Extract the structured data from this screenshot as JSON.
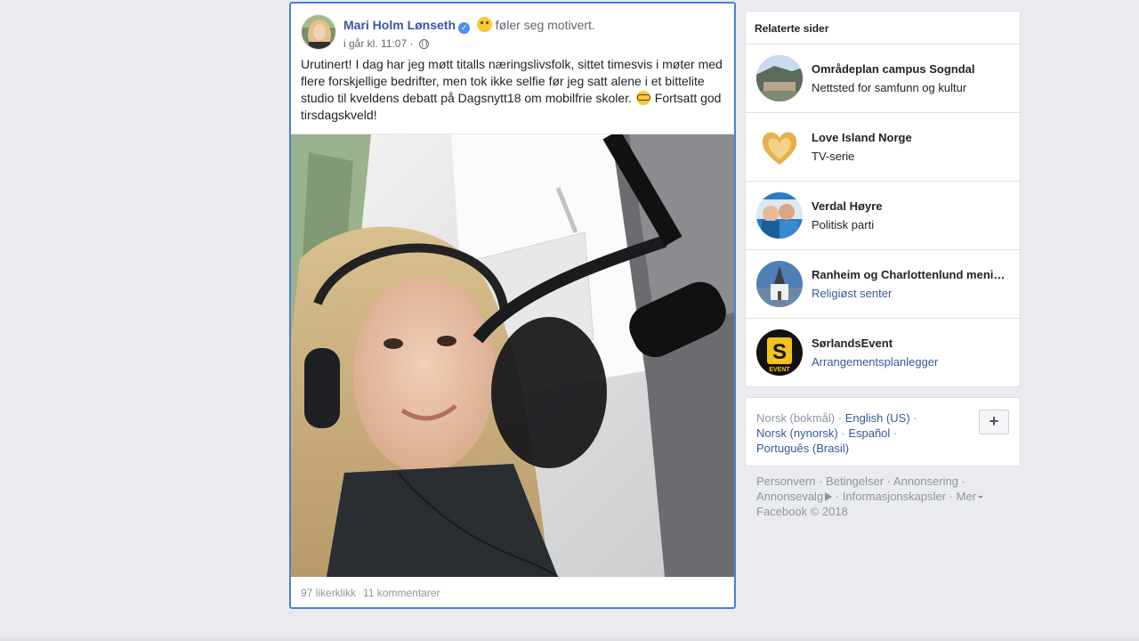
{
  "post": {
    "author": "Mari Holm Lønseth",
    "feeling": "føler seg motivert.",
    "time": "i går kl. 11:07 ·",
    "text_part1": "Urutinert! I dag har jeg møtt titalls næringslivsfolk, sittet timesvis i møter med flere forskjellige bedrifter, men tok ikke selfie før jeg satt alene i et bittelite studio til kveldens debatt på Dagsnytt18 om mobilfrie skoler.",
    "text_part2": "Fortsatt god tirsdagskveld!",
    "likes": "97 likerklikk",
    "comments": "11 kommentarer",
    "accent_color": "#4a7fdc",
    "link_color": "#385898",
    "icons": [
      "verified-icon",
      "feeling-emoji-icon",
      "globe-icon",
      "nerd-emoji-icon"
    ]
  },
  "related": {
    "title": "Relaterte sider",
    "items": [
      {
        "name": "Områdeplan campus Sogndal",
        "subtitle": "Nettsted for samfunn og kultur",
        "subtitle_is_link": false
      },
      {
        "name": "Love Island Norge",
        "subtitle": "TV-serie",
        "subtitle_is_link": false
      },
      {
        "name": "Verdal Høyre",
        "subtitle": "Politisk parti",
        "subtitle_is_link": false
      },
      {
        "name": "Ranheim og Charlottenlund menighet",
        "subtitle": "Religiøst senter",
        "subtitle_is_link": true
      },
      {
        "name": "SørlandsEvent",
        "subtitle": "Arrangementsplanlegger",
        "subtitle_is_link": true
      }
    ]
  },
  "languages": {
    "current": "Norsk (bokmål)",
    "options": [
      "English (US)",
      "Norsk (nynorsk)",
      "Español",
      "Português (Brasil)"
    ],
    "add_label": "+"
  },
  "footer": {
    "links": [
      "Personvern",
      "Betingelser",
      "Annonsering",
      "Annonsevalg",
      "Informasjonskapsler",
      "Mer"
    ],
    "copyright": "Facebook © 2018"
  }
}
